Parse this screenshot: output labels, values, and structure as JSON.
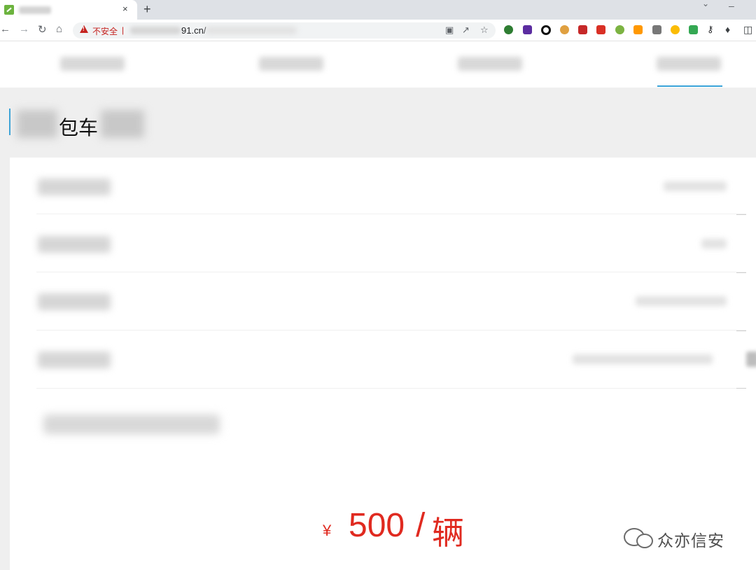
{
  "browser": {
    "tab_close": "×",
    "new_tab": "+",
    "security_label": "不安全",
    "separator": "|",
    "url_visible": "91.cn/",
    "icons": [
      "back-icon",
      "forward-icon",
      "reload-icon",
      "home-icon",
      "translate-icon",
      "share-icon",
      "star-icon",
      "puzzle-icon",
      "sidebar-icon"
    ],
    "extension_colors": [
      "#2e7d32",
      "#5b2ca0",
      "#111111",
      "#e0a040",
      "#c62828",
      "#d93025",
      "#7cb342",
      "#ff9800",
      "#555555",
      "#fbbc04",
      "#34a853",
      "#202124"
    ]
  },
  "page": {
    "title_visible": "包车",
    "price": {
      "currency": "¥",
      "amount": "500",
      "slash": "/",
      "unit": "辆",
      "color": "#e02a20"
    },
    "accent_color": "#3aa3d8"
  },
  "watermark": {
    "text": "众亦信安"
  }
}
